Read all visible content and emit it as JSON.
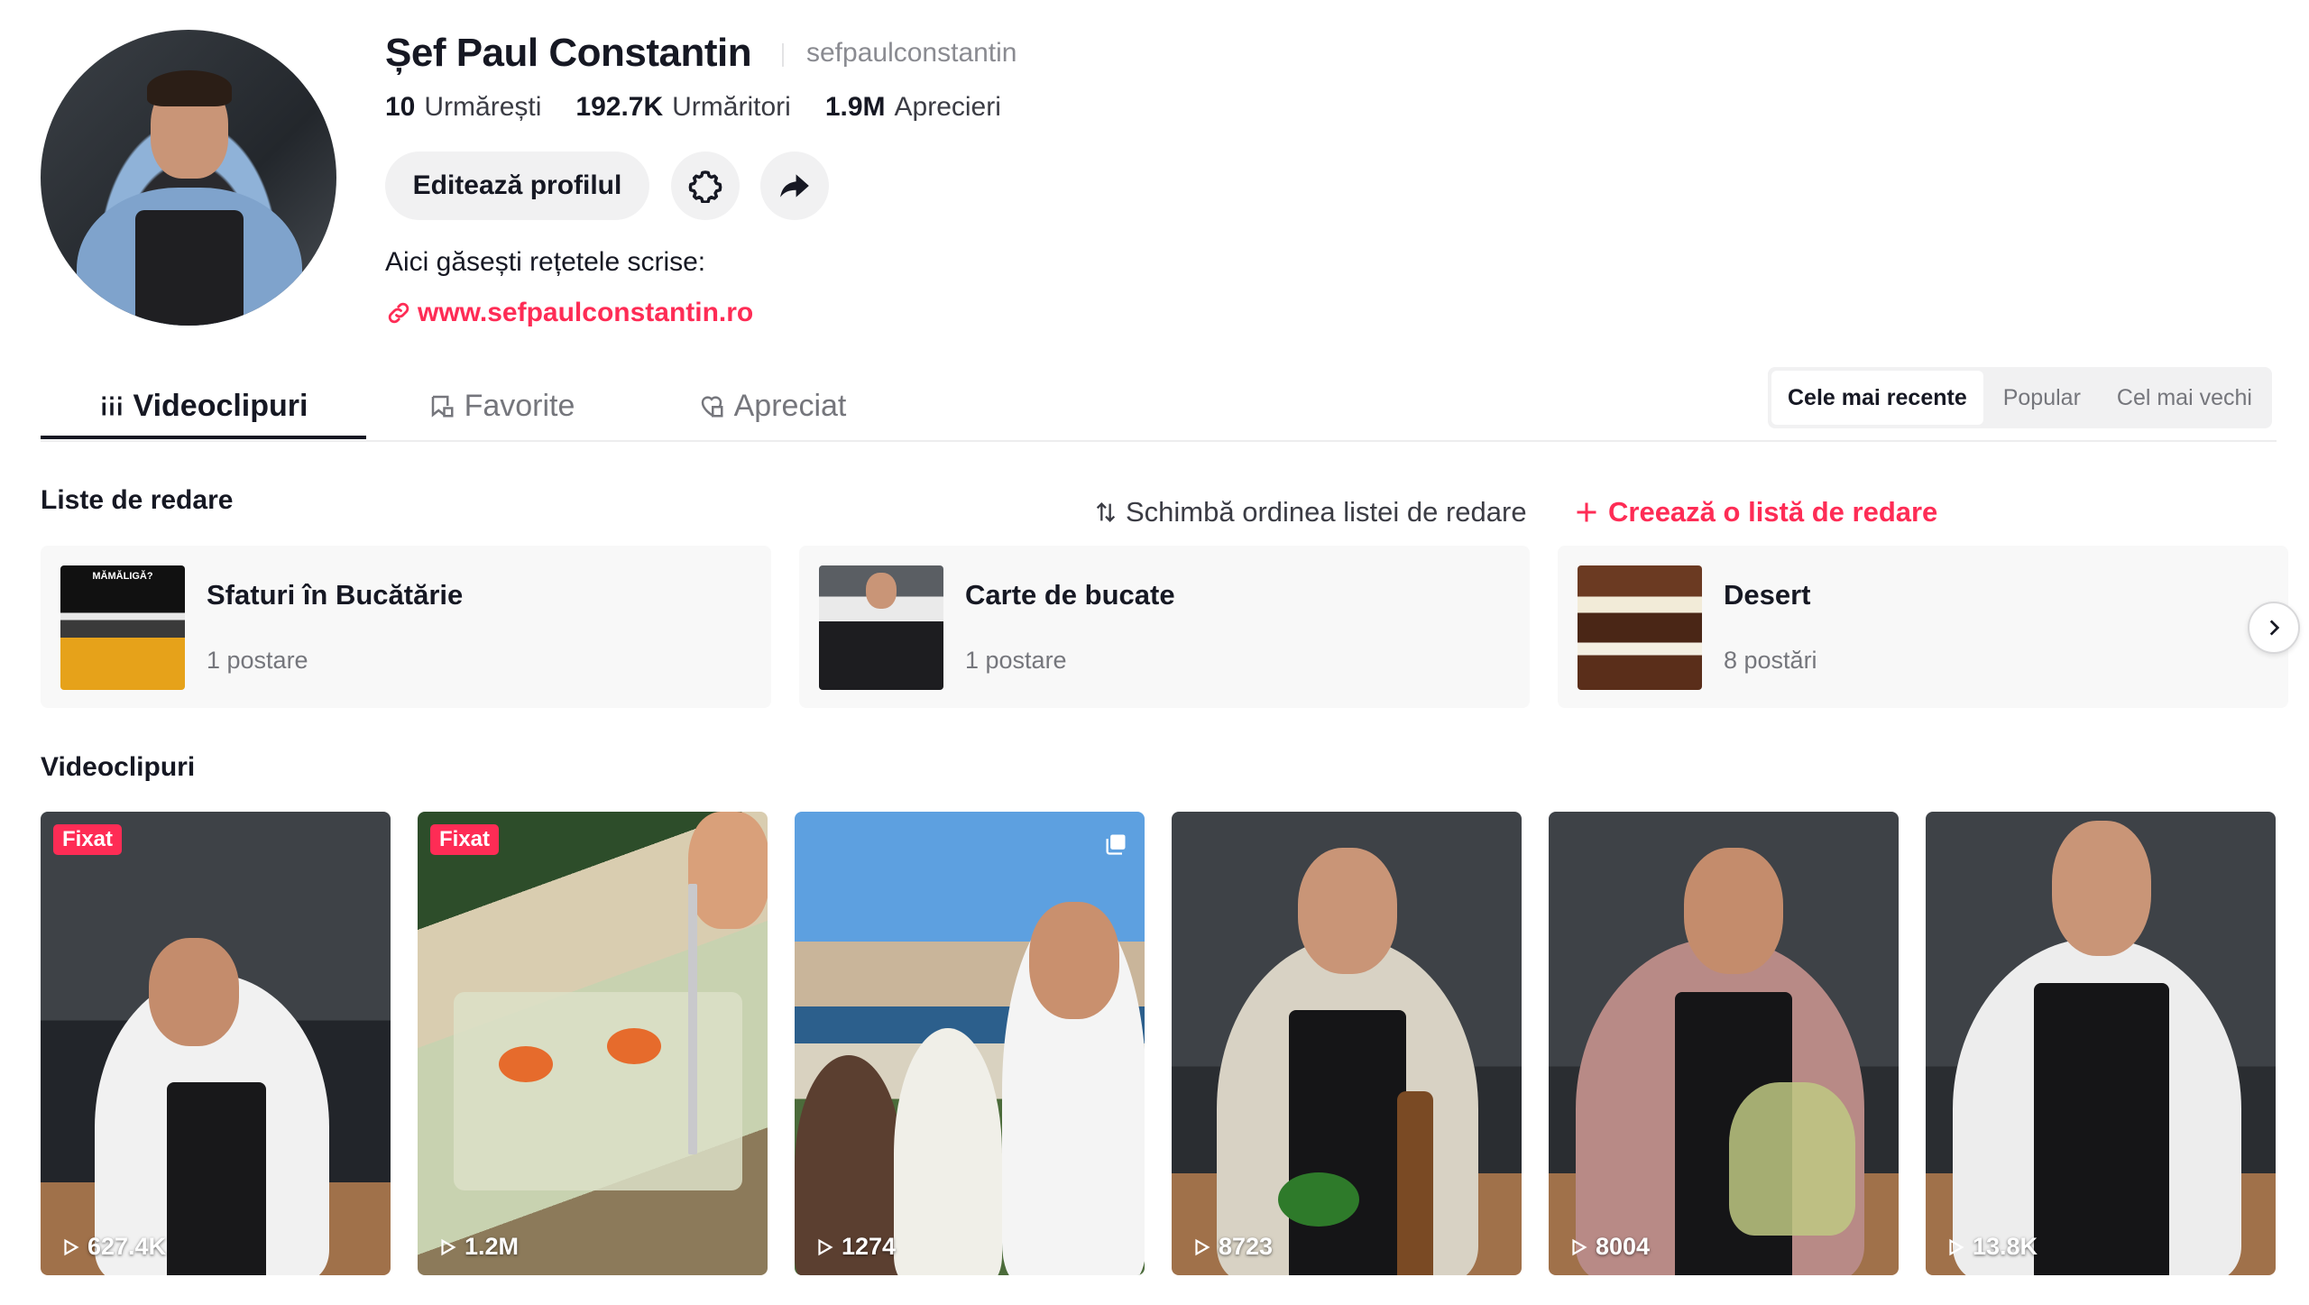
{
  "profile": {
    "name": "Șef Paul Constantin",
    "handle": "sefpaulconstantin",
    "stats": [
      {
        "value": "10",
        "label": "Urmărești"
      },
      {
        "value": "192.7K",
        "label": "Urmăritori"
      },
      {
        "value": "1.9M",
        "label": "Aprecieri"
      }
    ],
    "edit_label": "Editează profilul",
    "bio": "Aici găsești rețetele scrise:",
    "link": "www.sefpaulconstantin.ro"
  },
  "tabs": [
    {
      "label": "Videoclipuri",
      "icon": "grid-icon",
      "active": true
    },
    {
      "label": "Favorite",
      "icon": "bookmark-icon",
      "active": false
    },
    {
      "label": "Apreciat",
      "icon": "heart-icon",
      "active": false
    }
  ],
  "sort": {
    "options": [
      "Cele mai recente",
      "Popular",
      "Cel mai vechi"
    ],
    "selected": "Cele mai recente"
  },
  "playlists": {
    "title": "Liste de redare",
    "reorder_label": "Schimbă ordinea listei de redare",
    "create_label": "Creează o listă de redare",
    "items": [
      {
        "name": "Sfaturi în Bucătărie",
        "count": "1 postare",
        "thumb_text": "MĂMĂLIGĂ?"
      },
      {
        "name": "Carte de bucate",
        "count": "1 postare"
      },
      {
        "name": "Desert",
        "count": "8 postări"
      }
    ]
  },
  "videos": {
    "title": "Videoclipuri",
    "pinned_label": "Fixat",
    "items": [
      {
        "views": "627.4K",
        "pinned": true
      },
      {
        "views": "1.2M",
        "pinned": true
      },
      {
        "views": "1274",
        "pinned": false,
        "multi": true
      },
      {
        "views": "8723",
        "pinned": false
      },
      {
        "views": "8004",
        "pinned": false
      },
      {
        "views": "13.8K",
        "pinned": false
      }
    ]
  },
  "colors": {
    "accent": "#fe2c55",
    "text": "#161823",
    "muted": "#75767c"
  }
}
